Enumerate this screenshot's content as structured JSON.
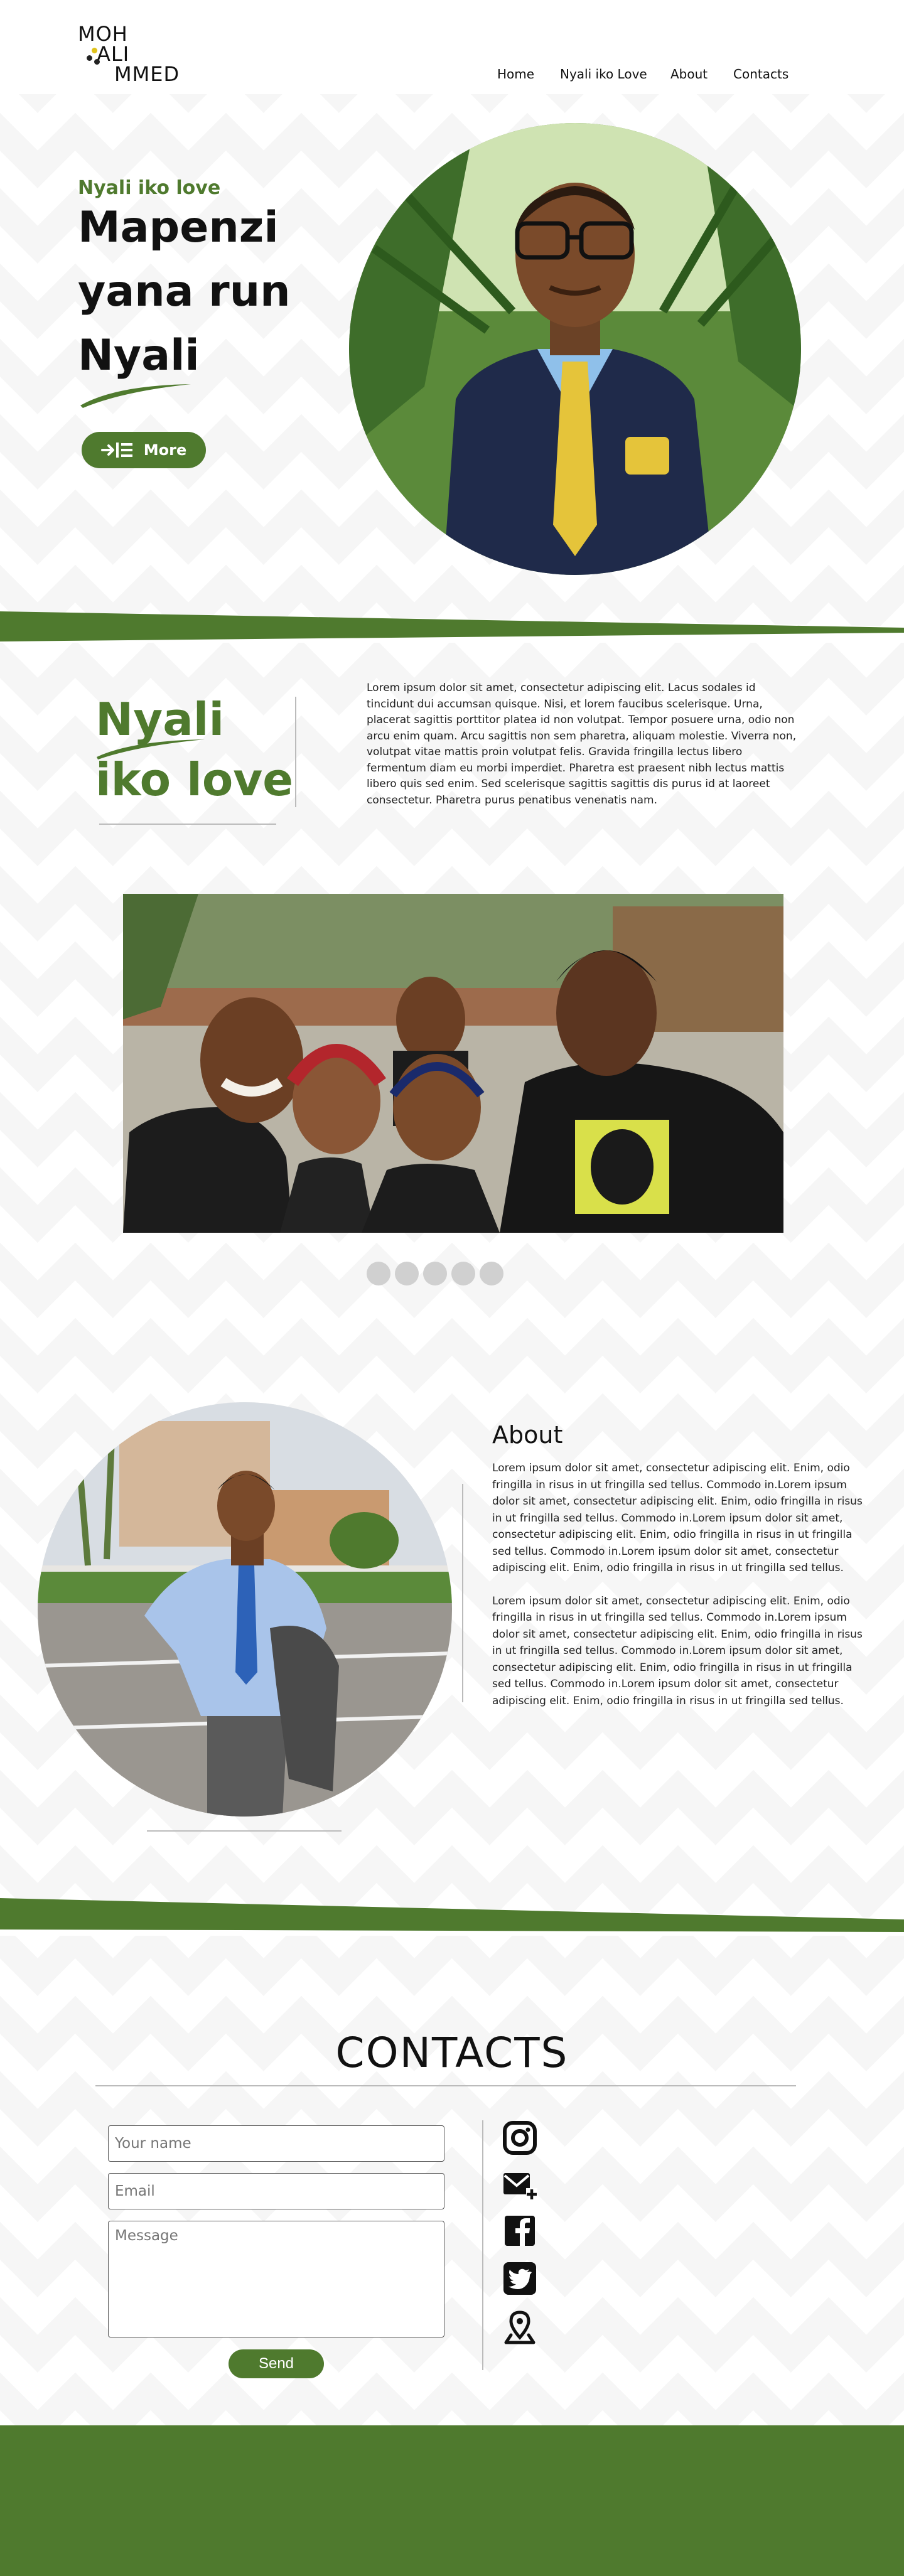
{
  "header": {
    "logo_lines": [
      "MOH",
      "ALI",
      "MMED"
    ],
    "nav": [
      "Home",
      "Nyali iko Love",
      "About",
      "Contacts"
    ]
  },
  "hero": {
    "kicker": "Nyali iko love",
    "title_line1": "Mapenzi",
    "title_line2": "yana run",
    "title_line3": "Nyali",
    "more_label": "More",
    "more_icon": "indent-list-icon",
    "portrait_alt": "Man in pinstripe suit with yellow tie"
  },
  "intro": {
    "title_line1": "Nyali",
    "title_line2": "iko love",
    "text": "Lorem ipsum dolor sit amet, consectetur adipiscing elit. Lacus sodales id tincidunt dui accumsan quisque. Nisi, et lorem faucibus scelerisque. Urna, placerat sagittis porttitor platea id non volutpat. Tempor posuere urna, odio non arcu enim quam. Arcu sagittis non sem pharetra, aliquam molestie. Viverra non, volutpat vitae mattis proin volutpat felis. Gravida fringilla lectus libero fermentum diam eu morbi imperdiet. Pharetra est praesent nibh lectus mattis libero quis sed enim. Sed scelerisque sagittis sagittis dis purus id at laoreet consectetur. Pharetra purus penatibus venenatis nam."
  },
  "carousel": {
    "dot_count": 5
  },
  "about": {
    "heading": "About",
    "paragraph1": "Lorem ipsum dolor sit amet, consectetur adipiscing elit. Enim, odio fringilla in risus in ut fringilla sed tellus. Commodo in.Lorem ipsum dolor sit amet, consectetur adipiscing elit. Enim, odio fringilla in risus in ut fringilla sed tellus. Commodo in.Lorem ipsum dolor sit amet, consectetur adipiscing elit. Enim, odio fringilla in risus in ut fringilla sed tellus. Commodo in.Lorem ipsum dolor sit amet, consectetur adipiscing elit. Enim, odio fringilla in risus in ut fringilla sed tellus.",
    "paragraph2": "Lorem ipsum dolor sit amet, consectetur adipiscing elit. Enim, odio fringilla in risus in ut fringilla sed tellus. Commodo in.Lorem ipsum dolor sit amet, consectetur adipiscing elit. Enim, odio fringilla in risus in ut fringilla sed tellus. Commodo in.Lorem ipsum dolor sit amet, consectetur adipiscing elit. Enim, odio fringilla in risus in ut fringilla sed tellus. Commodo in.Lorem ipsum dolor sit amet, consectetur adipiscing elit. Enim, odio fringilla in risus in ut fringilla sed tellus."
  },
  "contacts": {
    "title": "CONTACTS",
    "name_placeholder": "Your name",
    "email_placeholder": "Email",
    "message_placeholder": "Message",
    "send_label": "Send",
    "social_icons": [
      "instagram-icon",
      "email-add-icon",
      "facebook-icon",
      "twitter-icon",
      "location-pin-icon"
    ]
  },
  "colors": {
    "brand_green": "#4f7a2e",
    "logo_dot_yellow": "#e0c21a",
    "logo_dot_dark": "#222222"
  }
}
